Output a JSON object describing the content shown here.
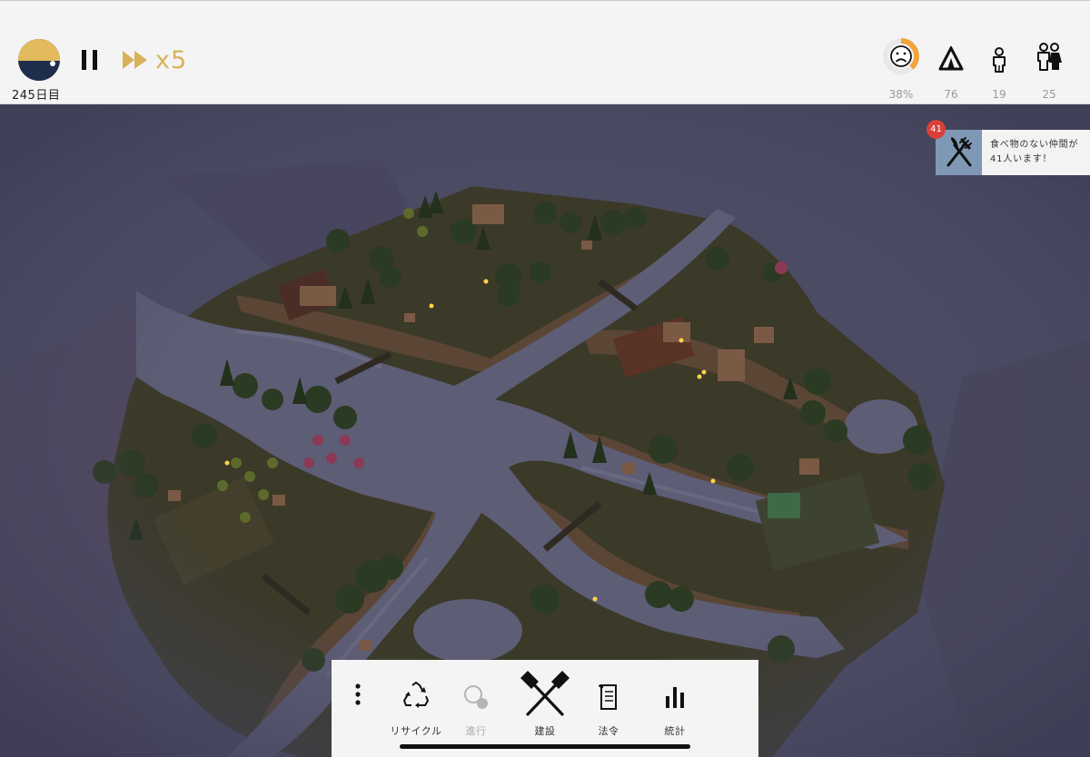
{
  "hud": {
    "day_label": "245日目",
    "speed_label": "x5",
    "stats": [
      {
        "name": "happiness",
        "icon": "sad-face-icon",
        "value": "38%",
        "fraction": 0.38
      },
      {
        "name": "shelter",
        "icon": "tent-icon",
        "value": "76"
      },
      {
        "name": "children",
        "icon": "child-icon",
        "value": "19"
      },
      {
        "name": "adults",
        "icon": "adults-icon",
        "value": "25"
      }
    ]
  },
  "notification": {
    "count": "41",
    "icon": "fork-knife-icon",
    "text": "食べ物のない仲間が41人います！"
  },
  "toolbar": {
    "more_icon": "more-vertical-icon",
    "recycle_label": "リサイクル",
    "progress_label": "進行",
    "build_label": "建設",
    "law_label": "法令",
    "stats_label": "統計"
  },
  "colors": {
    "accent_gold": "#d8b25a",
    "night_navy": "#1f2d4d",
    "happiness_orange": "#f0a53a",
    "badge_red": "#d8403a",
    "notify_blue": "#7f98b5",
    "ground": "#3e3b2a",
    "water": "#5e5e76",
    "fog": "#4a4a63"
  }
}
